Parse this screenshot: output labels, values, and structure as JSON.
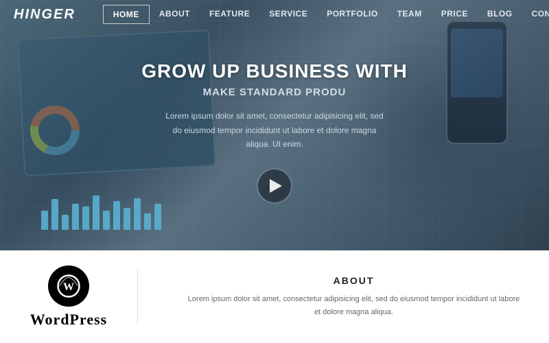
{
  "logo": {
    "text": "HINGER"
  },
  "nav": {
    "items": [
      {
        "label": "HOME",
        "active": true
      },
      {
        "label": "ABOUT",
        "active": false
      },
      {
        "label": "FEATURE",
        "active": false
      },
      {
        "label": "SERVICE",
        "active": false
      },
      {
        "label": "PORTFOLIO",
        "active": false
      },
      {
        "label": "TEAM",
        "active": false
      },
      {
        "label": "PRICE",
        "active": false
      },
      {
        "label": "BLOG",
        "active": false
      },
      {
        "label": "CONTACT",
        "active": false
      }
    ]
  },
  "hero": {
    "title": "GROW UP BUSINESS WITH",
    "subtitle": "MAKE STANDARD PRODU",
    "description": "Lorem ipsum dolor sit amet, consectetur adipisicing elit, sed do eiusmod tempor incididunt ut labore et dolore magna aliqua. Ut enim.",
    "play_label": "Play video"
  },
  "bottom": {
    "wordpress_label": "WordPress",
    "about_title": "ABOUT",
    "about_text": "Lorem ipsum dolor sit amet, consectetur adipisicing elit, sed do eiusmod tempor incididunt ut labore et dolore magna aliqua."
  },
  "bars": [
    40,
    55,
    30,
    50,
    45,
    60,
    38,
    52,
    42,
    58,
    35,
    48
  ]
}
